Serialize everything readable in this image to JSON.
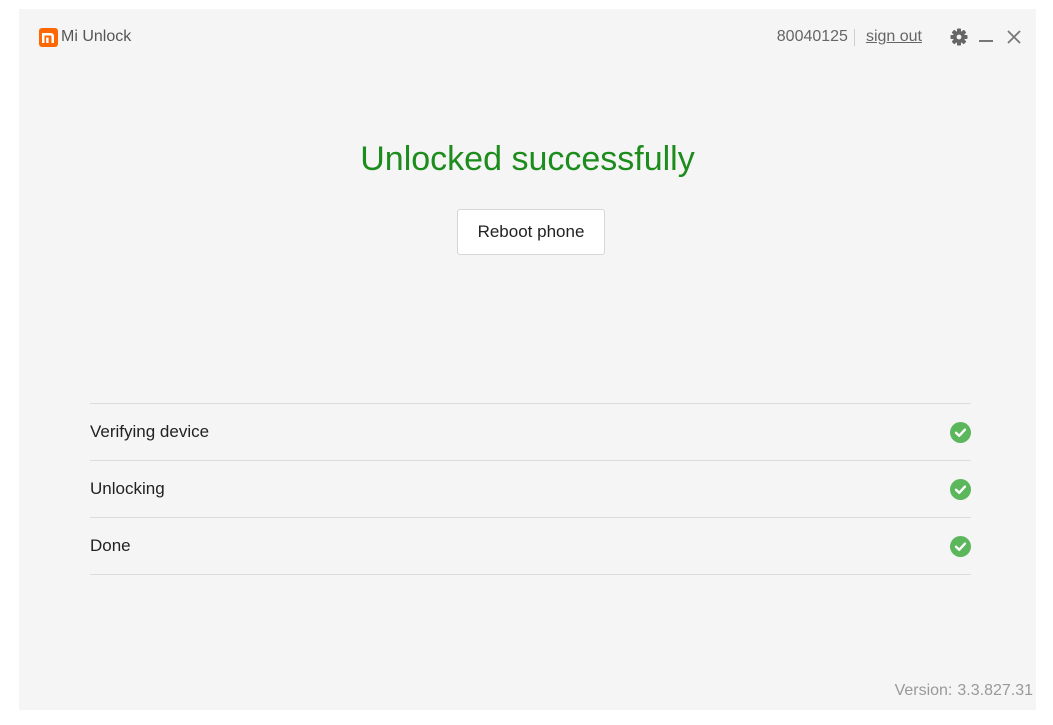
{
  "window": {
    "app_name": "Mi Unlock",
    "account_id": "80040125",
    "sign_out_label": "sign out",
    "icons": {
      "logo": "mi-logo-icon",
      "settings": "gear-icon",
      "minimize": "minimize-icon",
      "close": "close-icon"
    }
  },
  "main": {
    "status_title": "Unlocked successfully",
    "reboot_button_label": "Reboot phone"
  },
  "steps": [
    {
      "label": "Verifying device",
      "status": "done",
      "icon": "check-circle-icon"
    },
    {
      "label": "Unlocking",
      "status": "done",
      "icon": "check-circle-icon"
    },
    {
      "label": "Done",
      "status": "done",
      "icon": "check-circle-icon"
    }
  ],
  "footer": {
    "version_label": "Version:",
    "version_value": "3.3.827.31"
  },
  "colors": {
    "brand": "#ff6700",
    "success_text": "#1c8c1c",
    "success_icon": "#5cb65c",
    "background": "#f5f5f5"
  }
}
